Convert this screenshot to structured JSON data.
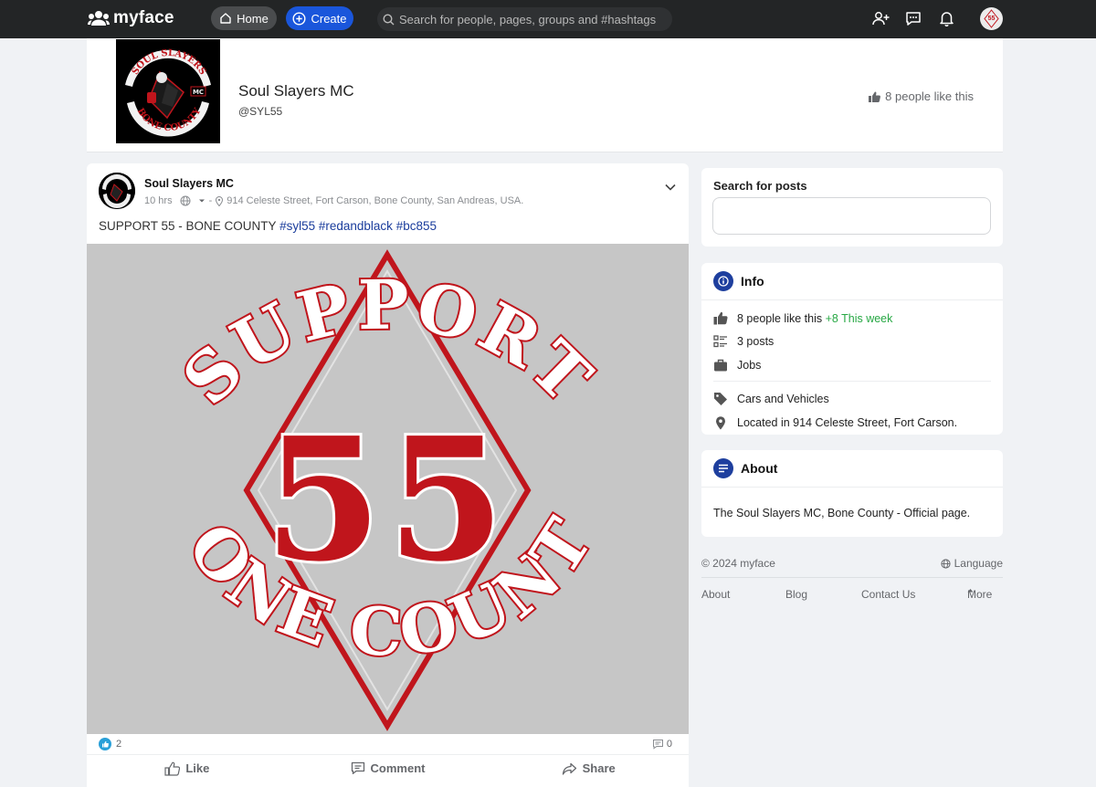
{
  "topbar": {
    "brand": "myface",
    "home_label": "Home",
    "create_label": "Create",
    "search_placeholder": "Search for people, pages, groups and #hashtags",
    "avatar_text": "55"
  },
  "page": {
    "name": "Soul Slayers MC",
    "handle": "@SYL55",
    "likes_text": "8 people like this",
    "logo_arc_top": "SOUL SLAYERS",
    "logo_arc_bottom": "BONE COUNTY",
    "logo_badge": "MC"
  },
  "post": {
    "author": "Soul Slayers MC",
    "time": "10 hrs",
    "separator": "-",
    "location": "914 Celeste Street, Fort Carson, Bone County, San Andreas, USA.",
    "text": "SUPPORT 55 - BONE COUNTY",
    "hashtags": [
      "#syl55",
      "#redandblack",
      "#bc855"
    ],
    "image": {
      "arc_top": "SUPPORT",
      "number": "55",
      "arc_bottom": "BONE COUNTY"
    },
    "reaction_count": "2",
    "comment_count": "0",
    "actions": {
      "like": "Like",
      "comment": "Comment",
      "share": "Share"
    }
  },
  "sidebar": {
    "search": {
      "label": "Search for posts",
      "placeholder": ""
    },
    "info": {
      "title": "Info",
      "likes": "8 people like this",
      "likes_week": "+8 This week",
      "posts": "3 posts",
      "jobs": "Jobs",
      "category": "Cars and Vehicles",
      "location": "Located in 914 Celeste Street, Fort Carson."
    },
    "about": {
      "title": "About",
      "text": "The Soul Slayers MC, Bone County - Official page."
    }
  },
  "footer": {
    "copyright": "© 2024 myface",
    "language": "Language",
    "links": [
      "About",
      "Blog",
      "Contact Us",
      "More"
    ]
  },
  "colors": {
    "topbar": "#232526",
    "accent": "#1a56db",
    "hashtag": "#1a3c9c",
    "week_green": "#27a844",
    "patch_red": "#c0151c"
  }
}
